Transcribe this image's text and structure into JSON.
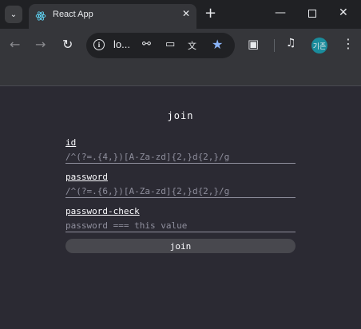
{
  "browser": {
    "tab_title": "React App",
    "url": "lo...",
    "avatar_label": "기존",
    "icons": {
      "tab_search": "chevron-down-icon",
      "tab_favicon": "react-icon",
      "tab_close": "close-icon",
      "new_tab": "plus-icon",
      "minimize": "minimize-icon",
      "maximize": "maximize-icon",
      "close_window": "close-icon",
      "back": "arrow-left-icon",
      "forward": "arrow-right-icon",
      "reload": "reload-icon",
      "site_info": "info-icon",
      "passwords": "key-icon",
      "install": "install-icon",
      "translate": "translate-icon",
      "bookmark": "star-icon",
      "extensions": "puzzle-icon",
      "media": "media-icon",
      "menu": "kebab-menu-icon"
    },
    "colors": {
      "accent_star": "#8ab4f8",
      "avatar_bg": "#1a8c9c"
    }
  },
  "form": {
    "title": "join",
    "fields": [
      {
        "label": "id",
        "placeholder": "/^(?=.{4,})[A-Za-zd]{2,}d{2,}/g",
        "value": ""
      },
      {
        "label": "password",
        "placeholder": "/^(?=.{6,})[A-Za-zd]{2,}d{2,}/g",
        "value": ""
      },
      {
        "label": "password-check",
        "placeholder": "password === this value",
        "value": ""
      }
    ],
    "submit_label": "join"
  }
}
